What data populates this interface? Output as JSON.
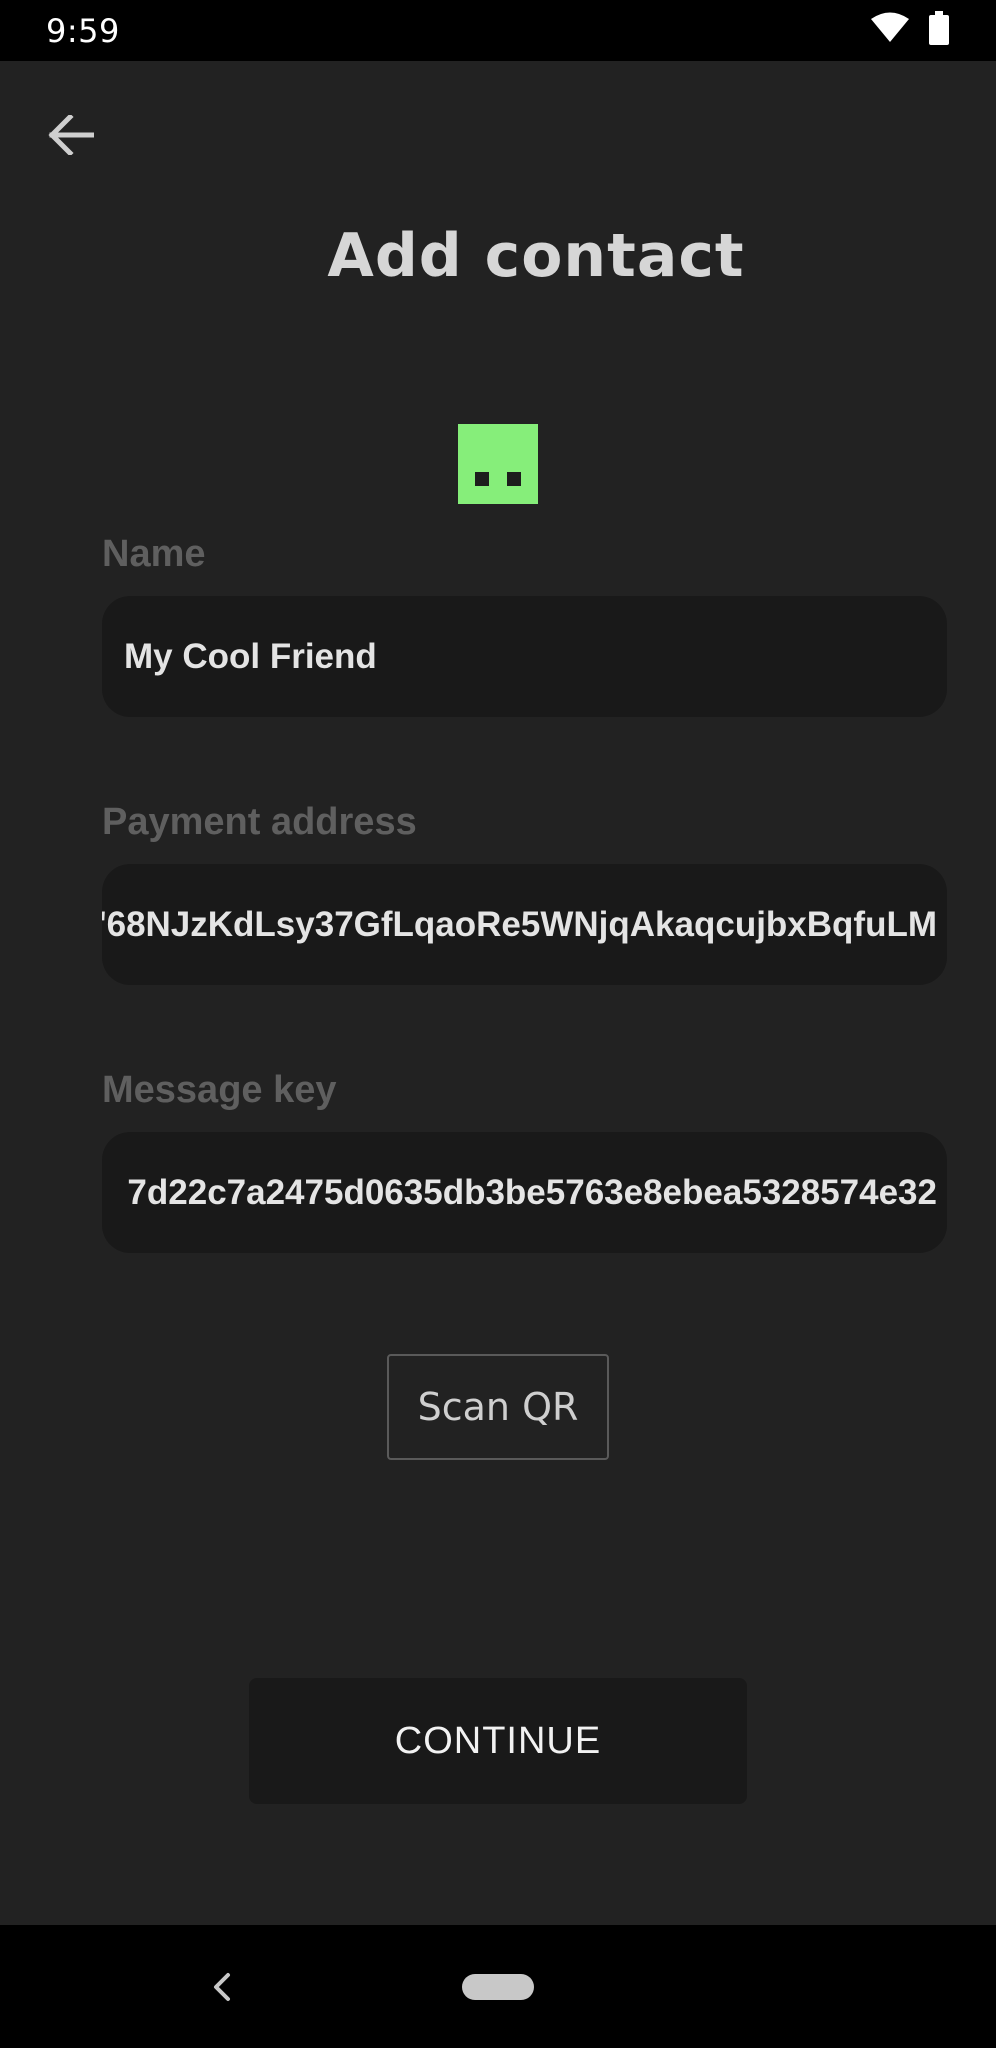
{
  "status_bar": {
    "time": "9:59",
    "icons": [
      "wifi-icon",
      "battery-icon"
    ]
  },
  "header": {
    "back_icon": "arrow-left-icon",
    "title": "Add contact"
  },
  "avatar": {
    "color": "#86ee7a"
  },
  "form": {
    "name": {
      "label": "Name",
      "value": "My Cool Friend"
    },
    "payment_address": {
      "label": "Payment address",
      "value": "'68NJzKdLsy37GfLqaoRe5WNjqAkaqcujbxBqfuLM"
    },
    "message_key": {
      "label": "Message key",
      "value": "7d22c7a2475d0635db3be5763e8ebea5328574e32"
    }
  },
  "actions": {
    "scan_qr_label": "Scan QR",
    "continue_label": "CONTINUE"
  },
  "nav_bar": {
    "back_icon": "chevron-left-icon",
    "home_icon": "home-pill-icon"
  }
}
